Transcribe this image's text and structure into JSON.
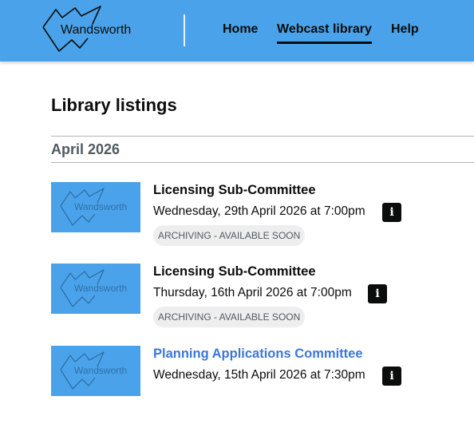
{
  "header": {
    "logo_text": "Wandsworth",
    "nav": [
      {
        "label": "Home"
      },
      {
        "label": "Webcast library",
        "active": true
      },
      {
        "label": "Help"
      }
    ],
    "background_color": "#4aa3ea"
  },
  "main": {
    "title": "Library listings",
    "month": "April 2026",
    "items": [
      {
        "thumb_text": "Wandsworth",
        "title": "Licensing Sub-Committee",
        "date": "Wednesday, 29th April 2026 at 7:00pm",
        "status": "ARCHIVING - AVAILABLE SOON",
        "info_icon": "info-icon"
      },
      {
        "thumb_text": "Wandsworth",
        "title": "Licensing Sub-Committee",
        "date": "Thursday, 16th April 2026 at 7:00pm",
        "status": "ARCHIVING - AVAILABLE SOON",
        "info_icon": "info-icon"
      },
      {
        "thumb_text": "Wandsworth",
        "title": "Planning Applications Committee",
        "date": "Wednesday, 15th April 2026 at 7:30pm",
        "info_icon": "info-icon"
      }
    ],
    "link_color": "#3a78d8"
  }
}
